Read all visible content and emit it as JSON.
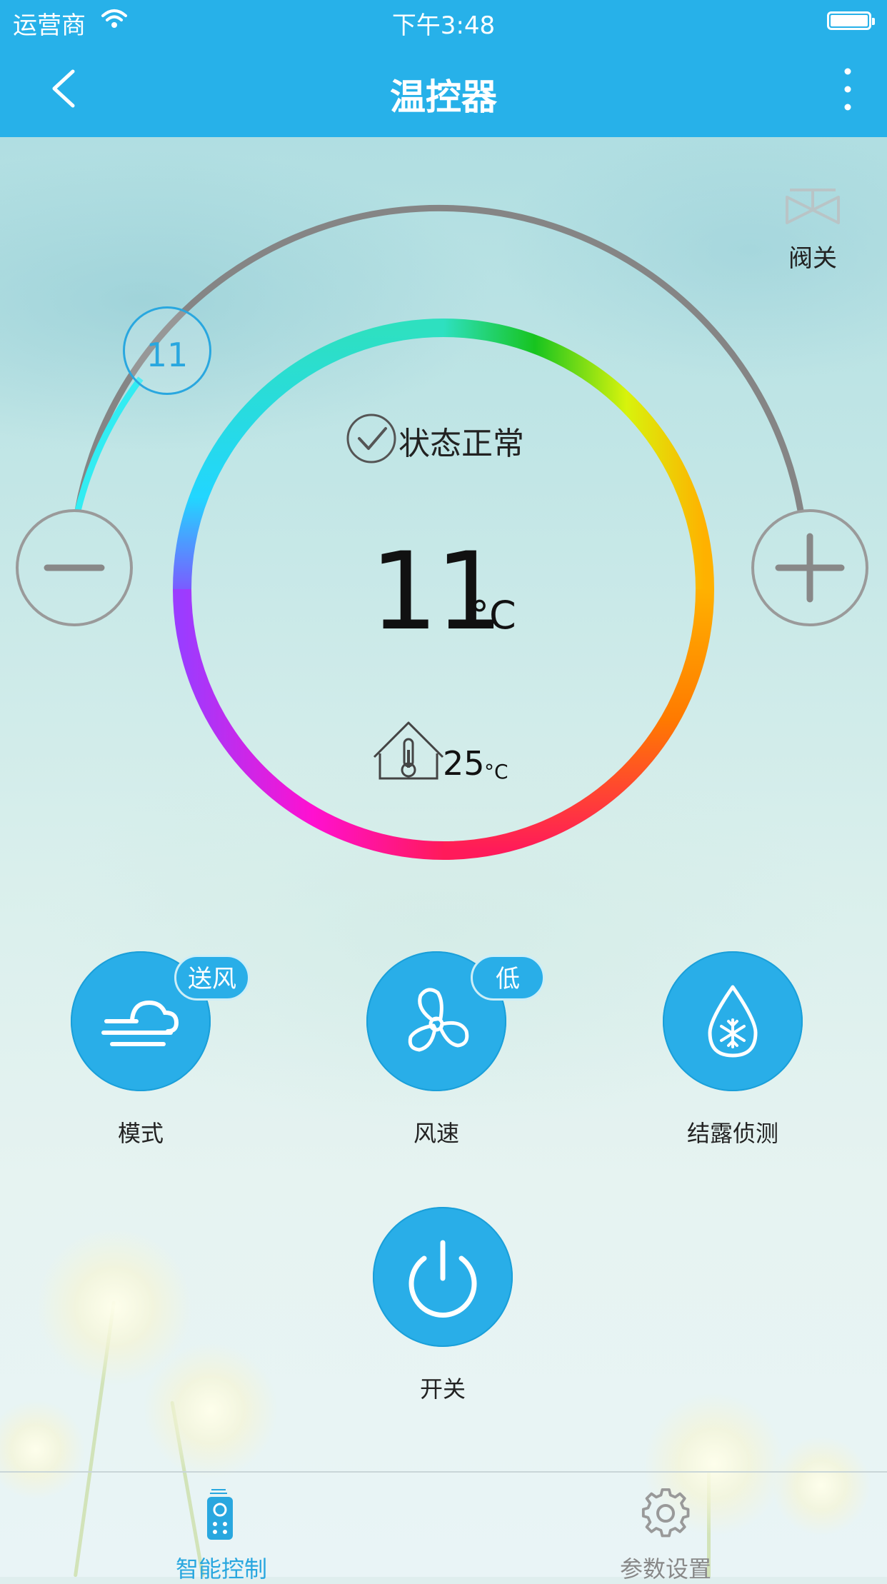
{
  "status_bar": {
    "carrier": "运营商",
    "time": "下午3:48"
  },
  "nav": {
    "title": "温控器",
    "back_icon": "chevron-left-icon",
    "more_icon": "more-vertical-icon"
  },
  "valve": {
    "label": "阀关",
    "icon": "valve-icon"
  },
  "dial": {
    "setpoint_knob": "11",
    "status": "状态正常",
    "set_temp": "11",
    "set_unit": "°C",
    "room_temp": "25",
    "room_unit": "°C"
  },
  "controls": {
    "mode": {
      "label": "模式",
      "badge": "送风",
      "icon": "wind-cloud-icon"
    },
    "fan_speed": {
      "label": "风速",
      "badge": "低",
      "icon": "fan-icon"
    },
    "dew": {
      "label": "结露侦测",
      "icon": "snowflake-drop-icon"
    },
    "power": {
      "label": "开关",
      "icon": "power-icon"
    }
  },
  "tabs": [
    {
      "label": "智能控制",
      "icon": "remote-control-icon",
      "active": true
    },
    {
      "label": "参数设置",
      "icon": "gear-icon",
      "active": false
    }
  ],
  "colors": {
    "primary": "#27b1e9",
    "active_tab": "#29a7df",
    "inactive_tab": "#888888"
  }
}
